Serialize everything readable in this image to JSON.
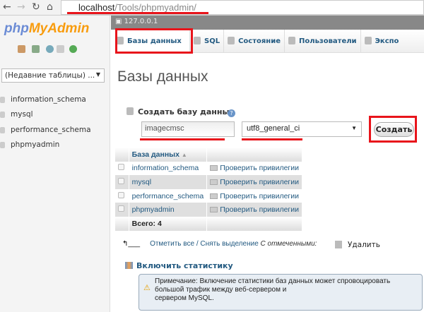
{
  "browser": {
    "url_host": "localhost",
    "url_path": "/Tools/phpmyadmin/"
  },
  "sidebar": {
    "logo_php": "php",
    "logo_myadmin": "MyAdmin",
    "recent_tables": "(Недавние таблицы) ...",
    "databases": [
      "information_schema",
      "mysql",
      "performance_schema",
      "phpmyadmin"
    ]
  },
  "header": {
    "server": "127.0.0.1",
    "tabs": [
      "Базы данных",
      "SQL",
      "Состояние",
      "Пользователи",
      "Экспо"
    ]
  },
  "main": {
    "title": "Базы данных",
    "create_label": "Создать базу данных",
    "db_name_value": "imagecmsc",
    "collation_value": "utf8_general_ci",
    "create_button": "Создать",
    "table": {
      "header": "База данных",
      "rows": [
        {
          "name": "information_schema",
          "action": "Проверить привилегии"
        },
        {
          "name": "mysql",
          "action": "Проверить привилегии"
        },
        {
          "name": "performance_schema",
          "action": "Проверить привилегии"
        },
        {
          "name": "phpmyadmin",
          "action": "Проверить привилегии"
        }
      ],
      "total": "Всего: 4"
    },
    "check_all": "Отметить все",
    "uncheck_all": "Снять выделение",
    "with_selected": "С отмеченными:",
    "delete": "Удалить",
    "enable_stats": "Включить статистику",
    "note": "Примечание: Включение статистики баз данных может спровоцировать большой трафик между веб-сервером и",
    "note_line2": "сервером MySQL."
  },
  "annotation_color": "#e8141b"
}
